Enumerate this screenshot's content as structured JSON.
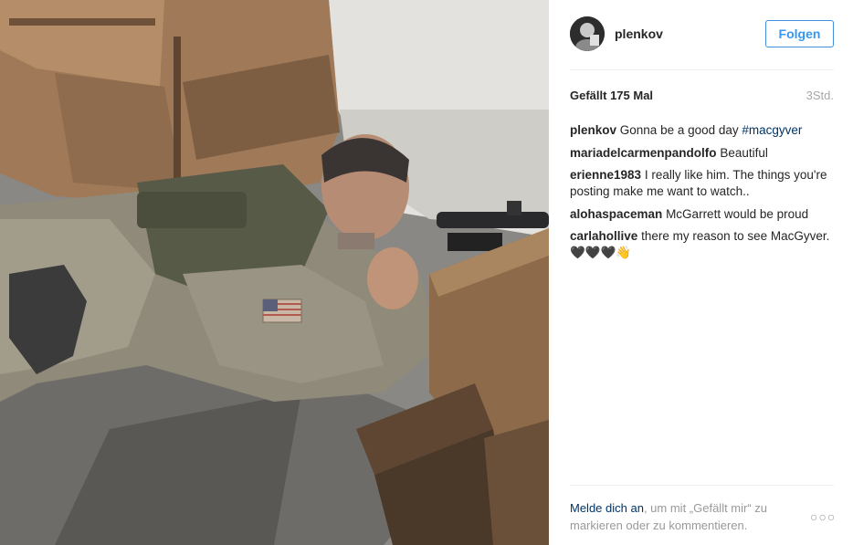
{
  "post": {
    "username": "plenkov",
    "follow_label": "Folgen",
    "likes": "Gefällt 175 Mal",
    "time": "3Std."
  },
  "comments": [
    {
      "user": "plenkov",
      "text": "Gonna be a good day ",
      "hashtag": "#macgyver"
    },
    {
      "user": "mariadelcarmenpandolfo",
      "text": "Beautiful"
    },
    {
      "user": "erienne1983",
      "text": "I really like him. The things you're posting make me want to watch.."
    },
    {
      "user": "alohaspaceman",
      "text": "McGarrett would be proud"
    },
    {
      "user": "carlahollive",
      "text": "there my reason to see MacGyver. 🖤🖤🖤👋"
    }
  ],
  "footer": {
    "login_link": "Melde dich an",
    "login_text": ", um mit „Gefällt mir“ zu markieren oder zu kommentieren.",
    "more_label": "○○○"
  },
  "icons": {
    "more": "ellipsis-icon"
  },
  "colors": {
    "link": "#003569",
    "follow": "#3897f0",
    "muted": "#999999"
  }
}
